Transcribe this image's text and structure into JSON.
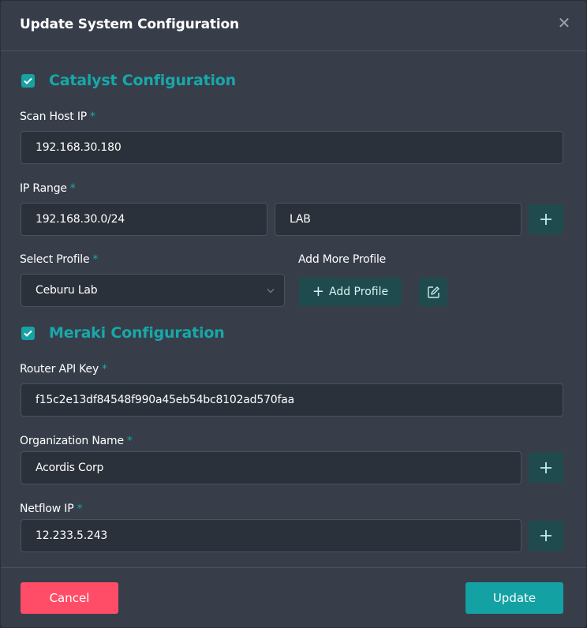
{
  "modal": {
    "title": "Update System Configuration",
    "close_icon": "close-icon"
  },
  "catalyst": {
    "checked": true,
    "section_title": "Catalyst Configuration",
    "scan_host_ip": {
      "label": "Scan Host IP",
      "required": "*",
      "value": "192.168.30.180"
    },
    "ip_range": {
      "label": "IP Range",
      "required": "*",
      "value": "192.168.30.0/24",
      "name_value": "LAB"
    },
    "select_profile": {
      "label": "Select Profile",
      "required": "*",
      "value": "Ceburu Lab"
    },
    "add_more_profile": {
      "label": "Add More Profile",
      "button_label": "Add Profile"
    }
  },
  "meraki": {
    "checked": true,
    "section_title": "Meraki Configuration",
    "router_api_key": {
      "label": "Router API Key",
      "required": "*",
      "value": "f15c2e13df84548f990a45eb54bc8102ad570faa"
    },
    "organization_name": {
      "label": "Organization Name",
      "required": "*",
      "value": "Acordis Corp"
    },
    "netflow_ip": {
      "label": "Netflow IP",
      "required": "*",
      "value": "12.233.5.243"
    }
  },
  "footer": {
    "cancel_label": "Cancel",
    "update_label": "Update"
  },
  "colors": {
    "accent": "#17a8aa",
    "cancel": "#ff4d67",
    "modal_bg": "#373e49",
    "input_bg": "#2b313a"
  }
}
